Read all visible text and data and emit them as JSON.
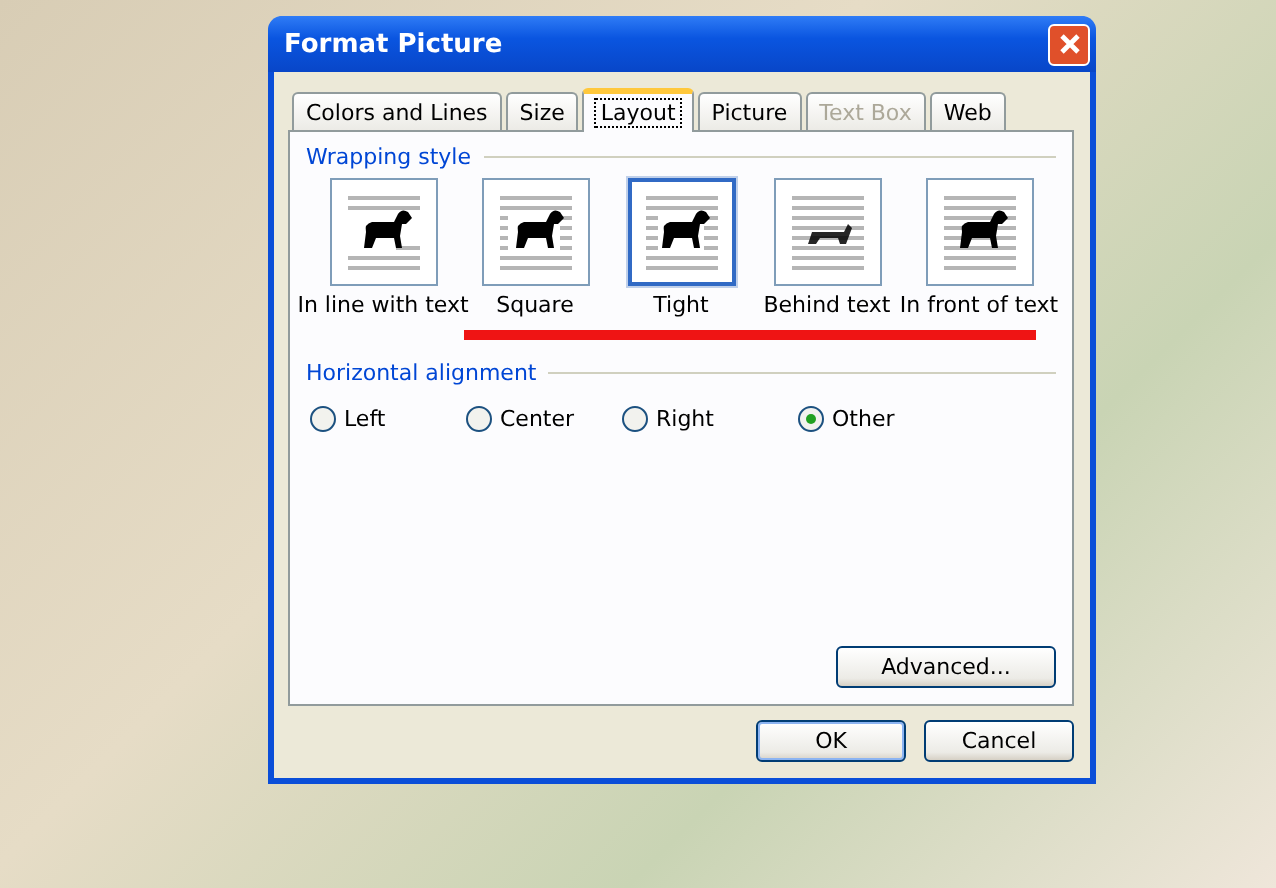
{
  "window": {
    "title": "Format Picture"
  },
  "tabs": [
    {
      "label": "Colors and Lines",
      "selected": false,
      "disabled": false
    },
    {
      "label": "Size",
      "selected": false,
      "disabled": false
    },
    {
      "label": "Layout",
      "selected": true,
      "disabled": false
    },
    {
      "label": "Picture",
      "selected": false,
      "disabled": false
    },
    {
      "label": "Text Box",
      "selected": false,
      "disabled": true
    },
    {
      "label": "Web",
      "selected": false,
      "disabled": false
    }
  ],
  "wrapping_style": {
    "heading": "Wrapping style",
    "options": [
      {
        "label": "In line with text",
        "kind": "inline",
        "selected": false
      },
      {
        "label": "Square",
        "kind": "square",
        "selected": false
      },
      {
        "label": "Tight",
        "kind": "tight",
        "selected": true
      },
      {
        "label": "Behind text",
        "kind": "behind",
        "selected": false
      },
      {
        "label": "In front of text",
        "kind": "front",
        "selected": false
      }
    ]
  },
  "horizontal_alignment": {
    "heading": "Horizontal alignment",
    "options": [
      {
        "label": "Left",
        "selected": false
      },
      {
        "label": "Center",
        "selected": false
      },
      {
        "label": "Right",
        "selected": false
      },
      {
        "label": "Other",
        "selected": true
      }
    ]
  },
  "advanced_button": "Advanced...",
  "buttons": [
    "OK",
    "Cancel"
  ]
}
